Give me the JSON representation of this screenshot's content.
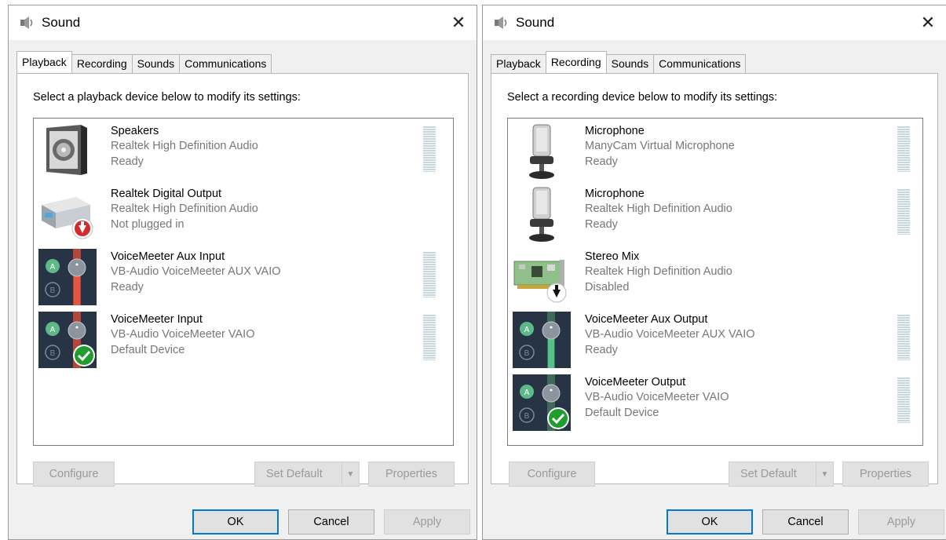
{
  "dialogs": [
    {
      "title": "Sound",
      "tabs": [
        "Playback",
        "Recording",
        "Sounds",
        "Communications"
      ],
      "active_tab": 0,
      "instruction": "Select a playback device below to modify its settings:",
      "devices": [
        {
          "name": "Speakers",
          "driver": "Realtek High Definition Audio",
          "status": "Ready",
          "icon": "speaker-icon"
        },
        {
          "name": "Realtek Digital Output",
          "driver": "Realtek High Definition Audio",
          "status": "Not plugged in",
          "icon": "digital-output-icon"
        },
        {
          "name": "VoiceMeeter Aux Input",
          "driver": "VB-Audio VoiceMeeter AUX VAIO",
          "status": "Ready",
          "icon": "voicemeeter-icon"
        },
        {
          "name": "VoiceMeeter Input",
          "driver": "VB-Audio VoiceMeeter VAIO",
          "status": "Default Device",
          "icon": "voicemeeter-default-icon"
        }
      ],
      "buttons": {
        "configure": "Configure",
        "set_default": "Set Default",
        "properties": "Properties",
        "ok": "OK",
        "cancel": "Cancel",
        "apply": "Apply"
      }
    },
    {
      "title": "Sound",
      "tabs": [
        "Playback",
        "Recording",
        "Sounds",
        "Communications"
      ],
      "active_tab": 1,
      "instruction": "Select a recording device below to modify its settings:",
      "devices": [
        {
          "name": "Microphone",
          "driver": "ManyCam Virtual Microphone",
          "status": "Ready",
          "icon": "microphone-icon"
        },
        {
          "name": "Microphone",
          "driver": "Realtek High Definition Audio",
          "status": "Ready",
          "icon": "microphone-icon"
        },
        {
          "name": "Stereo Mix",
          "driver": "Realtek High Definition Audio",
          "status": "Disabled",
          "icon": "sound-card-icon"
        },
        {
          "name": "VoiceMeeter Aux Output",
          "driver": "VB-Audio VoiceMeeter AUX VAIO",
          "status": "Ready",
          "icon": "voicemeeter-icon"
        },
        {
          "name": "VoiceMeeter Output",
          "driver": "VB-Audio VoiceMeeter VAIO",
          "status": "Default Device",
          "icon": "voicemeeter-default-icon"
        }
      ],
      "buttons": {
        "configure": "Configure",
        "set_default": "Set Default",
        "properties": "Properties",
        "ok": "OK",
        "cancel": "Cancel",
        "apply": "Apply"
      }
    }
  ],
  "colors": {
    "accent": "#0078d7",
    "default_check": "#1f9e2f",
    "unplugged_arrow": "#c8102e",
    "voicemeeter_bg": "#273445",
    "aux_slider": "#e4573e",
    "aux_output_slider": "#55c28a"
  }
}
